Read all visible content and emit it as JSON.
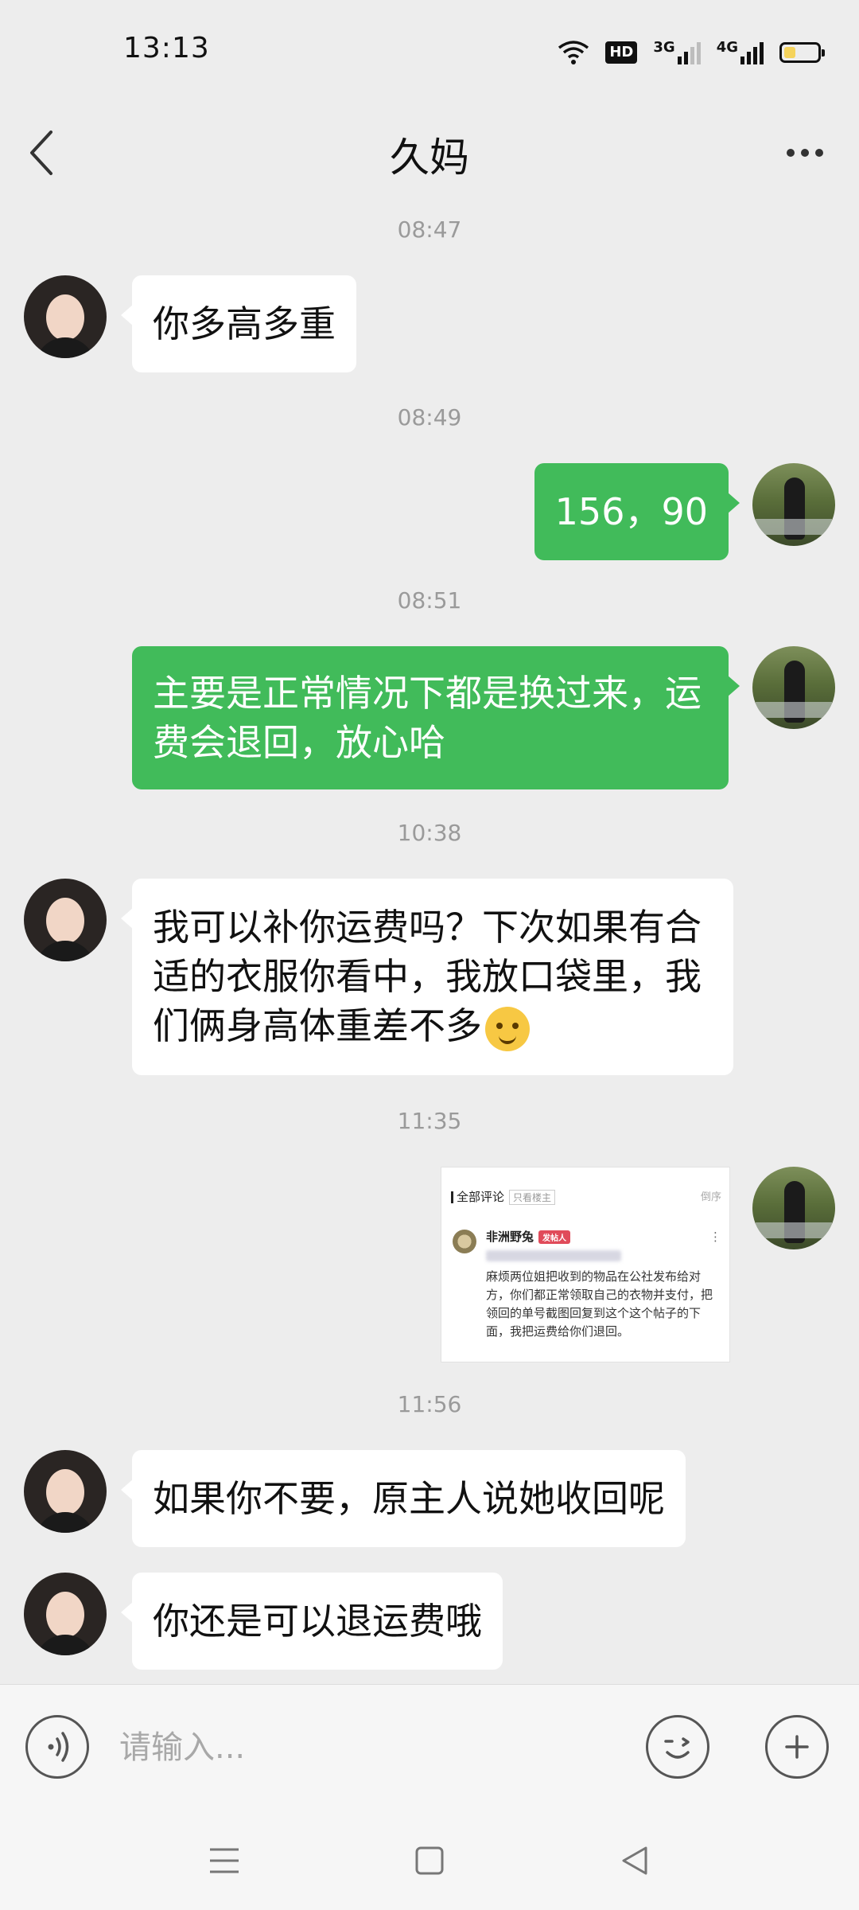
{
  "status_bar": {
    "time": "13:13",
    "hd_label": "HD",
    "net1": "3G",
    "net2": "4G",
    "battery_level": 0.35
  },
  "header": {
    "title": "久妈"
  },
  "messages": {
    "ts1": "08:47",
    "m1": "你多高多重",
    "ts2": "08:49",
    "m2": "156，90",
    "ts3": "08:51",
    "m3": "主要是正常情况下都是换过来，运费会退回，放心哈",
    "ts4": "10:38",
    "m4": "我可以补你运费吗？下次如果有合适的衣服你看中，我放口袋里，我们俩身高体重差不多",
    "ts5": "11:35",
    "ts6": "11:56",
    "m6": "如果你不要，原主人说她收回呢",
    "m7": "你还是可以退运费哦"
  },
  "image_message": {
    "header": "全部评论",
    "tag": "只看楼主",
    "sort": "倒序",
    "username": "非洲野兔",
    "badge": "发帖人",
    "body": "麻烦两位姐把收到的物品在公社发布给对方，你们都正常领取自己的衣物并支付，把领回的单号截图回复到这个这个帖子的下面，我把运费给你们退回。"
  },
  "input_bar": {
    "placeholder": "请输入..."
  },
  "colors": {
    "bubble_green": "#41bb5a",
    "bubble_white": "#ffffff",
    "background": "#ededed"
  }
}
